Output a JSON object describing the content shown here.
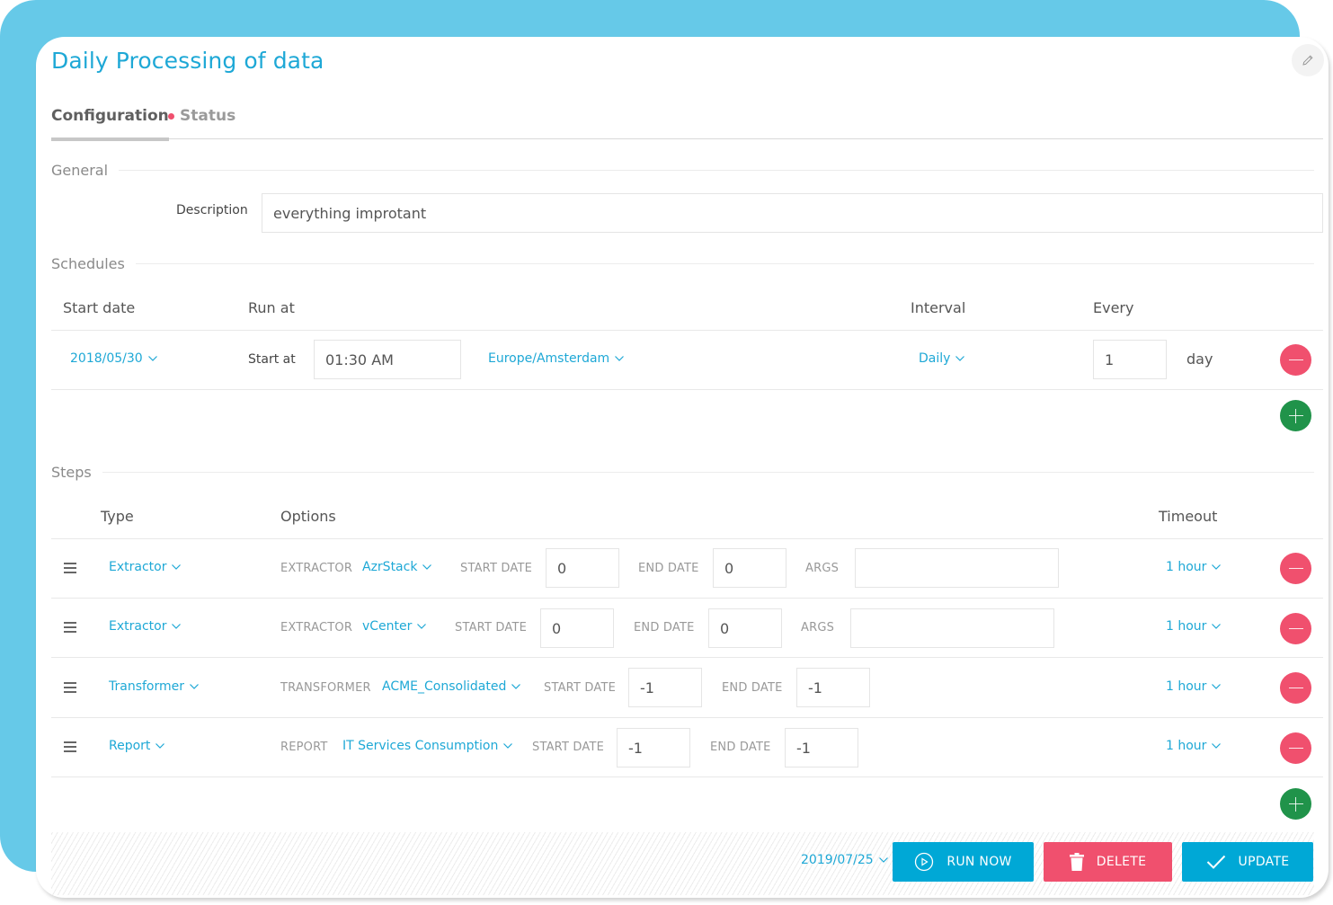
{
  "title": "Daily Processing of data",
  "tabs": [
    {
      "label": "Configuration",
      "active": true
    },
    {
      "label": "Status",
      "active": false,
      "indicator_color": "#f0506e"
    }
  ],
  "general": {
    "section_label": "General",
    "description_label": "Description",
    "description_value": "everything improtant"
  },
  "schedules": {
    "section_label": "Schedules",
    "headers": {
      "start_date": "Start date",
      "run_at": "Run at",
      "interval": "Interval",
      "every": "Every"
    },
    "rows": [
      {
        "start_date": "2018/05/30",
        "start_at_label": "Start at",
        "time": "01:30 AM",
        "timezone": "Europe/Amsterdam",
        "interval": "Daily",
        "every_value": "1",
        "every_unit": "day"
      }
    ]
  },
  "steps": {
    "section_label": "Steps",
    "headers": {
      "type": "Type",
      "options": "Options",
      "timeout": "Timeout"
    },
    "labels": {
      "start_date": "START DATE",
      "end_date": "END DATE",
      "args": "ARGS"
    },
    "rows": [
      {
        "type": "Extractor",
        "option_label": "EXTRACTOR",
        "option_value": "AzrStack",
        "start_date": "0",
        "end_date": "0",
        "args": "",
        "timeout": "1 hour"
      },
      {
        "type": "Extractor",
        "option_label": "EXTRACTOR",
        "option_value": "vCenter",
        "start_date": "0",
        "end_date": "0",
        "args": "",
        "timeout": "1 hour"
      },
      {
        "type": "Transformer",
        "option_label": "TRANSFORMER",
        "option_value": "ACME_Consolidated",
        "start_date": "-1",
        "end_date": "-1",
        "timeout": "1 hour"
      },
      {
        "type": "Report",
        "option_label": "REPORT",
        "option_value": "IT Services Consumption",
        "start_date": "-1",
        "end_date": "-1",
        "timeout": "1 hour"
      }
    ]
  },
  "footer": {
    "date": "2019/07/25",
    "run_now_label": "RUN NOW",
    "delete_label": "DELETE",
    "update_label": "UPDATE"
  },
  "colors": {
    "accent": "#1ea8d6",
    "primary_button": "#00a8d6",
    "danger": "#f0506e",
    "success": "#20934a",
    "background_shape": "#66c9e8"
  }
}
